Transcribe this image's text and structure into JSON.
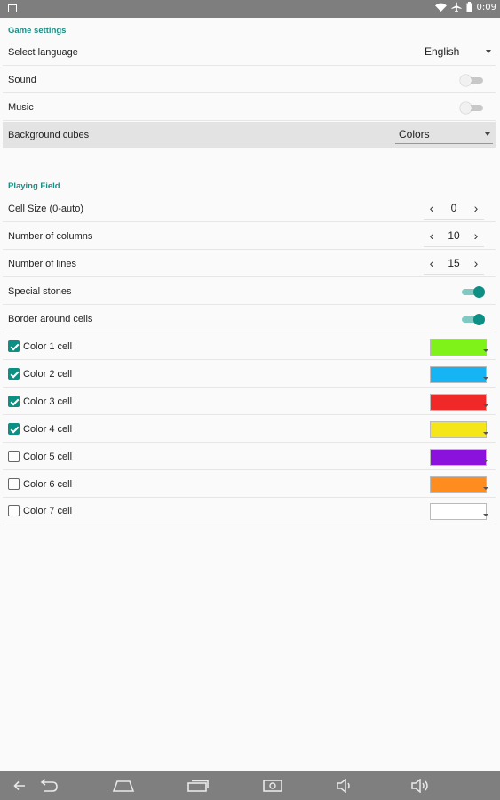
{
  "status_bar": {
    "time": "0:09",
    "icons": [
      "image-icon",
      "wifi-icon",
      "airplane-icon",
      "battery-icon"
    ]
  },
  "game_settings": {
    "title": "Game settings",
    "language": {
      "label": "Select language",
      "value": "English"
    },
    "sound": {
      "label": "Sound",
      "on": false
    },
    "music": {
      "label": "Music",
      "on": false
    },
    "background_cubes": {
      "label": "Background cubes",
      "value": "Colors"
    }
  },
  "playing_field": {
    "title": "Playing Field",
    "cell_size": {
      "label": "Cell Size (0-auto)",
      "value": "0"
    },
    "columns": {
      "label": "Number of columns",
      "value": "10"
    },
    "lines": {
      "label": "Number of lines",
      "value": "15"
    },
    "special_stones": {
      "label": "Special stones",
      "on": true
    },
    "border_cells": {
      "label": "Border around cells",
      "on": true
    },
    "stepper_minus": "‹",
    "stepper_plus": "›"
  },
  "colors": [
    {
      "label": "Color 1 cell",
      "checked": true,
      "color": "#7ff21a"
    },
    {
      "label": "Color 2 cell",
      "checked": true,
      "color": "#14b4f5"
    },
    {
      "label": "Color 3 cell",
      "checked": true,
      "color": "#f02828"
    },
    {
      "label": "Color 4 cell",
      "checked": true,
      "color": "#f5e61a"
    },
    {
      "label": "Color 5 cell",
      "checked": false,
      "color": "#8a12dc"
    },
    {
      "label": "Color 6 cell",
      "checked": false,
      "color": "#ff8c1e"
    },
    {
      "label": "Color 7 cell",
      "checked": false,
      "color": "#ffffff"
    }
  ],
  "accent_color": "#0c8f84",
  "nav_bar": {
    "icons": [
      "back-arrow-icon",
      "back-icon",
      "home-icon",
      "recent-apps-icon",
      "screenshot-icon",
      "volume-down-icon",
      "volume-up-icon"
    ]
  }
}
